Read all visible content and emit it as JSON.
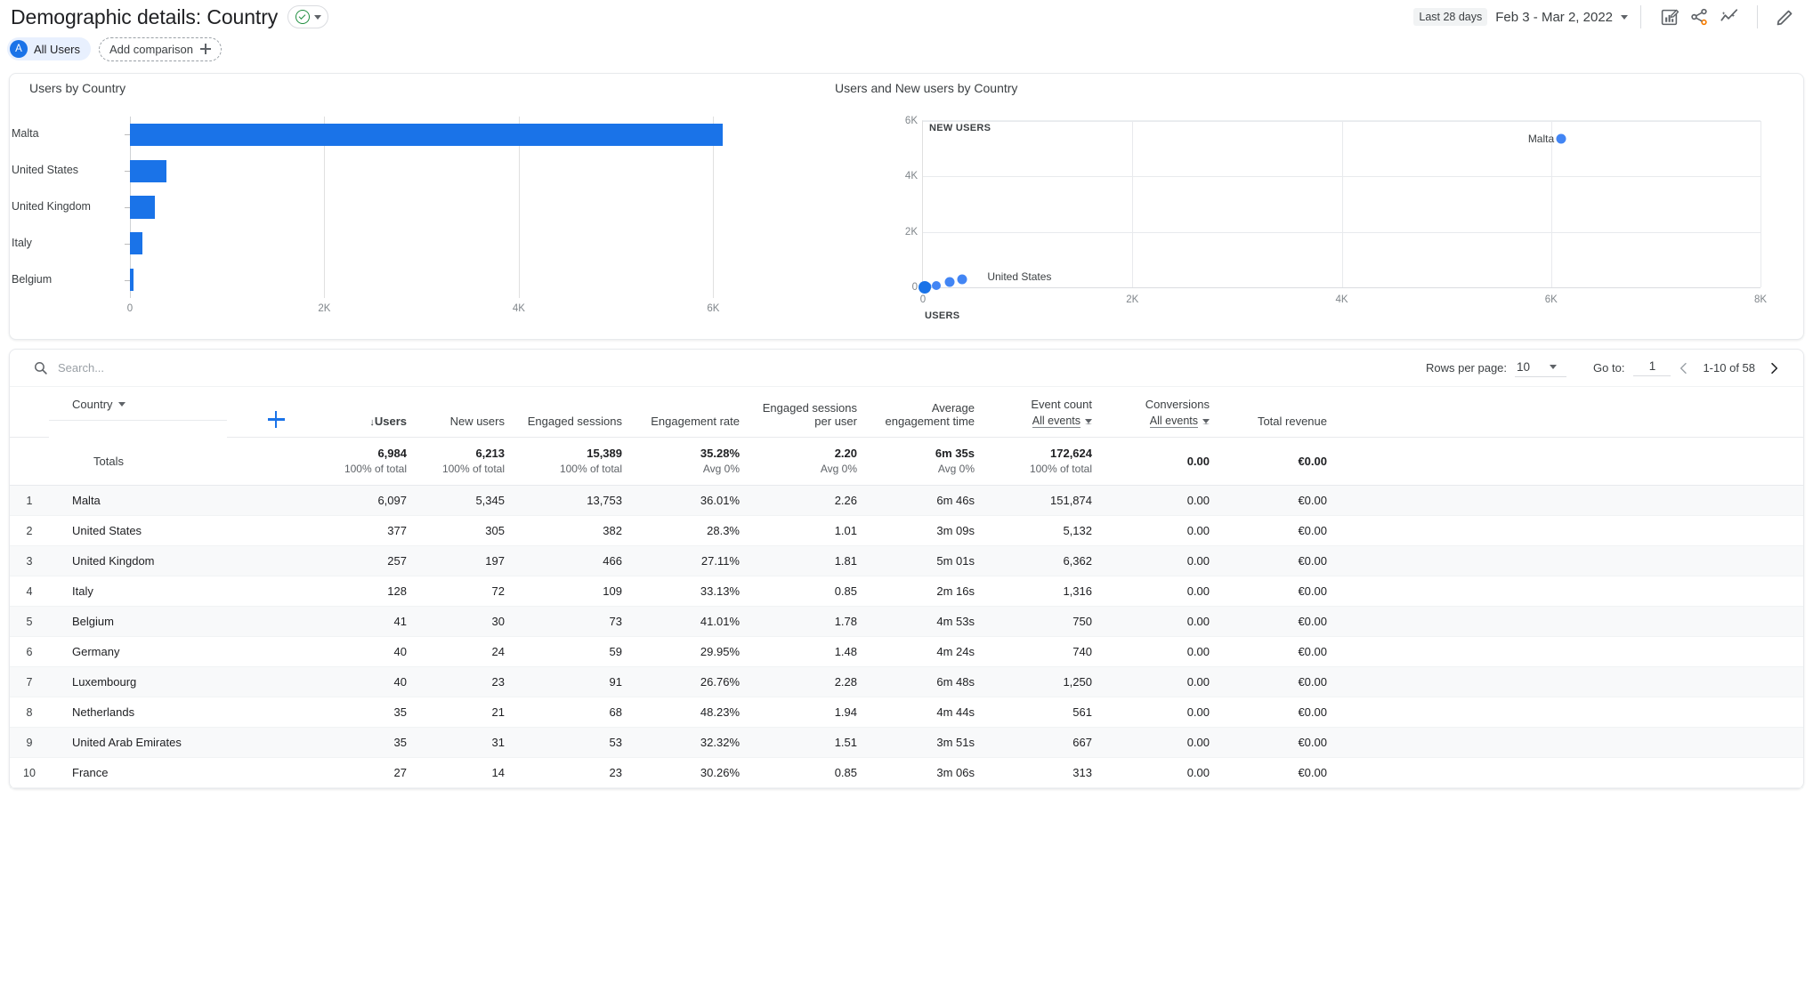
{
  "header": {
    "title": "Demographic details: Country",
    "status_icon": "check-circle-icon",
    "dropdown_icon": "chevron-down-icon",
    "date_badge": "Last 28 days",
    "date_range": "Feb 3 - Mar 2, 2022",
    "icons": [
      "edit-chart-icon",
      "share-icon",
      "insights-icon",
      "pencil-icon"
    ]
  },
  "comparison": {
    "avatar_letter": "A",
    "all_users_label": "All Users",
    "add_comparison_label": "Add comparison"
  },
  "charts": {
    "bar": {
      "title": "Users by Country"
    },
    "scatter": {
      "title": "Users and New users by Country"
    }
  },
  "chart_data": [
    {
      "type": "bar",
      "title": "Users by Country",
      "orientation": "horizontal",
      "categories": [
        "Malta",
        "United States",
        "United Kingdom",
        "Italy",
        "Belgium"
      ],
      "values": [
        6097,
        377,
        257,
        128,
        41
      ],
      "xlabel": "",
      "ylabel": "",
      "xlim": [
        0,
        6500
      ],
      "xticks": [
        0,
        2000,
        4000,
        6000
      ],
      "xtick_labels": [
        "0",
        "2K",
        "4K",
        "6K"
      ],
      "grid": true,
      "color": "#1a73e8"
    },
    {
      "type": "scatter",
      "title": "Users and New users by Country",
      "xlabel": "USERS",
      "ylabel": "NEW USERS",
      "xlim": [
        0,
        8000
      ],
      "ylim": [
        0,
        6000
      ],
      "xticks": [
        0,
        2000,
        4000,
        6000,
        8000
      ],
      "xtick_labels": [
        "0",
        "2K",
        "4K",
        "6K",
        "8K"
      ],
      "yticks": [
        0,
        2000,
        4000,
        6000
      ],
      "ytick_labels": [
        "0",
        "2K",
        "4K",
        "6K"
      ],
      "grid": true,
      "color": "#4285f4",
      "points": [
        {
          "label": "Malta",
          "x": 6097,
          "y": 5345,
          "size": 11,
          "show_label": true
        },
        {
          "label": "United States",
          "x": 377,
          "y": 305,
          "size": 11,
          "show_label": true
        },
        {
          "label": "United Kingdom",
          "x": 257,
          "y": 197,
          "size": 11,
          "show_label": false
        },
        {
          "label": "Italy",
          "x": 128,
          "y": 72,
          "size": 10,
          "show_label": false
        },
        {
          "label": "Belgium",
          "x": 41,
          "y": 30,
          "size": 9,
          "show_label": false
        },
        {
          "label": "Others",
          "x": 20,
          "y": 14,
          "size": 14,
          "show_label": false
        }
      ]
    }
  ],
  "table": {
    "search_placeholder": "Search...",
    "search_value": "",
    "search_icon": "search-icon",
    "rows_per_page_label": "Rows per page:",
    "rows_per_page_value": "10",
    "goto_label": "Go to:",
    "goto_value": "1",
    "range_text": "1-10 of 58",
    "prev_icon": "chevron-left-icon",
    "next_icon": "chevron-right-icon",
    "dimension_header": "Country",
    "add_dimension_icon": "plus-icon",
    "sort_indicator": "↓",
    "columns": [
      {
        "label": "Users",
        "sorted": true
      },
      {
        "label": "New users"
      },
      {
        "label": "Engaged sessions"
      },
      {
        "label": "Engagement rate"
      },
      {
        "label": "Engaged sessions per user"
      },
      {
        "label": "Average engagement time"
      },
      {
        "label": "Event count",
        "sub": "All events"
      },
      {
        "label": "Conversions",
        "sub": "All events"
      },
      {
        "label": "Total revenue"
      }
    ],
    "totals": {
      "label": "Totals",
      "cells": [
        {
          "value": "6,984",
          "sub": "100% of total"
        },
        {
          "value": "6,213",
          "sub": "100% of total"
        },
        {
          "value": "15,389",
          "sub": "100% of total"
        },
        {
          "value": "35.28%",
          "sub": "Avg 0%"
        },
        {
          "value": "2.20",
          "sub": "Avg 0%"
        },
        {
          "value": "6m 35s",
          "sub": "Avg 0%"
        },
        {
          "value": "172,624",
          "sub": "100% of total"
        },
        {
          "value": "0.00",
          "sub": ""
        },
        {
          "value": "€0.00",
          "sub": ""
        }
      ]
    },
    "rows": [
      {
        "rank": "1",
        "country": "Malta",
        "users": "6,097",
        "new_users": "5,345",
        "engaged_sessions": "13,753",
        "engagement_rate": "36.01%",
        "sessions_per_user": "2.26",
        "avg_engagement_time": "6m 46s",
        "event_count": "151,874",
        "conversions": "0.00",
        "total_revenue": "€0.00"
      },
      {
        "rank": "2",
        "country": "United States",
        "users": "377",
        "new_users": "305",
        "engaged_sessions": "382",
        "engagement_rate": "28.3%",
        "sessions_per_user": "1.01",
        "avg_engagement_time": "3m 09s",
        "event_count": "5,132",
        "conversions": "0.00",
        "total_revenue": "€0.00"
      },
      {
        "rank": "3",
        "country": "United Kingdom",
        "users": "257",
        "new_users": "197",
        "engaged_sessions": "466",
        "engagement_rate": "27.11%",
        "sessions_per_user": "1.81",
        "avg_engagement_time": "5m 01s",
        "event_count": "6,362",
        "conversions": "0.00",
        "total_revenue": "€0.00"
      },
      {
        "rank": "4",
        "country": "Italy",
        "users": "128",
        "new_users": "72",
        "engaged_sessions": "109",
        "engagement_rate": "33.13%",
        "sessions_per_user": "0.85",
        "avg_engagement_time": "2m 16s",
        "event_count": "1,316",
        "conversions": "0.00",
        "total_revenue": "€0.00"
      },
      {
        "rank": "5",
        "country": "Belgium",
        "users": "41",
        "new_users": "30",
        "engaged_sessions": "73",
        "engagement_rate": "41.01%",
        "sessions_per_user": "1.78",
        "avg_engagement_time": "4m 53s",
        "event_count": "750",
        "conversions": "0.00",
        "total_revenue": "€0.00"
      },
      {
        "rank": "6",
        "country": "Germany",
        "users": "40",
        "new_users": "24",
        "engaged_sessions": "59",
        "engagement_rate": "29.95%",
        "sessions_per_user": "1.48",
        "avg_engagement_time": "4m 24s",
        "event_count": "740",
        "conversions": "0.00",
        "total_revenue": "€0.00"
      },
      {
        "rank": "7",
        "country": "Luxembourg",
        "users": "40",
        "new_users": "23",
        "engaged_sessions": "91",
        "engagement_rate": "26.76%",
        "sessions_per_user": "2.28",
        "avg_engagement_time": "6m 48s",
        "event_count": "1,250",
        "conversions": "0.00",
        "total_revenue": "€0.00"
      },
      {
        "rank": "8",
        "country": "Netherlands",
        "users": "35",
        "new_users": "21",
        "engaged_sessions": "68",
        "engagement_rate": "48.23%",
        "sessions_per_user": "1.94",
        "avg_engagement_time": "4m 44s",
        "event_count": "561",
        "conversions": "0.00",
        "total_revenue": "€0.00"
      },
      {
        "rank": "9",
        "country": "United Arab Emirates",
        "users": "35",
        "new_users": "31",
        "engaged_sessions": "53",
        "engagement_rate": "32.32%",
        "sessions_per_user": "1.51",
        "avg_engagement_time": "3m 51s",
        "event_count": "667",
        "conversions": "0.00",
        "total_revenue": "€0.00"
      },
      {
        "rank": "10",
        "country": "France",
        "users": "27",
        "new_users": "14",
        "engaged_sessions": "23",
        "engagement_rate": "30.26%",
        "sessions_per_user": "0.85",
        "avg_engagement_time": "3m 06s",
        "event_count": "313",
        "conversions": "0.00",
        "total_revenue": "€0.00"
      }
    ]
  }
}
